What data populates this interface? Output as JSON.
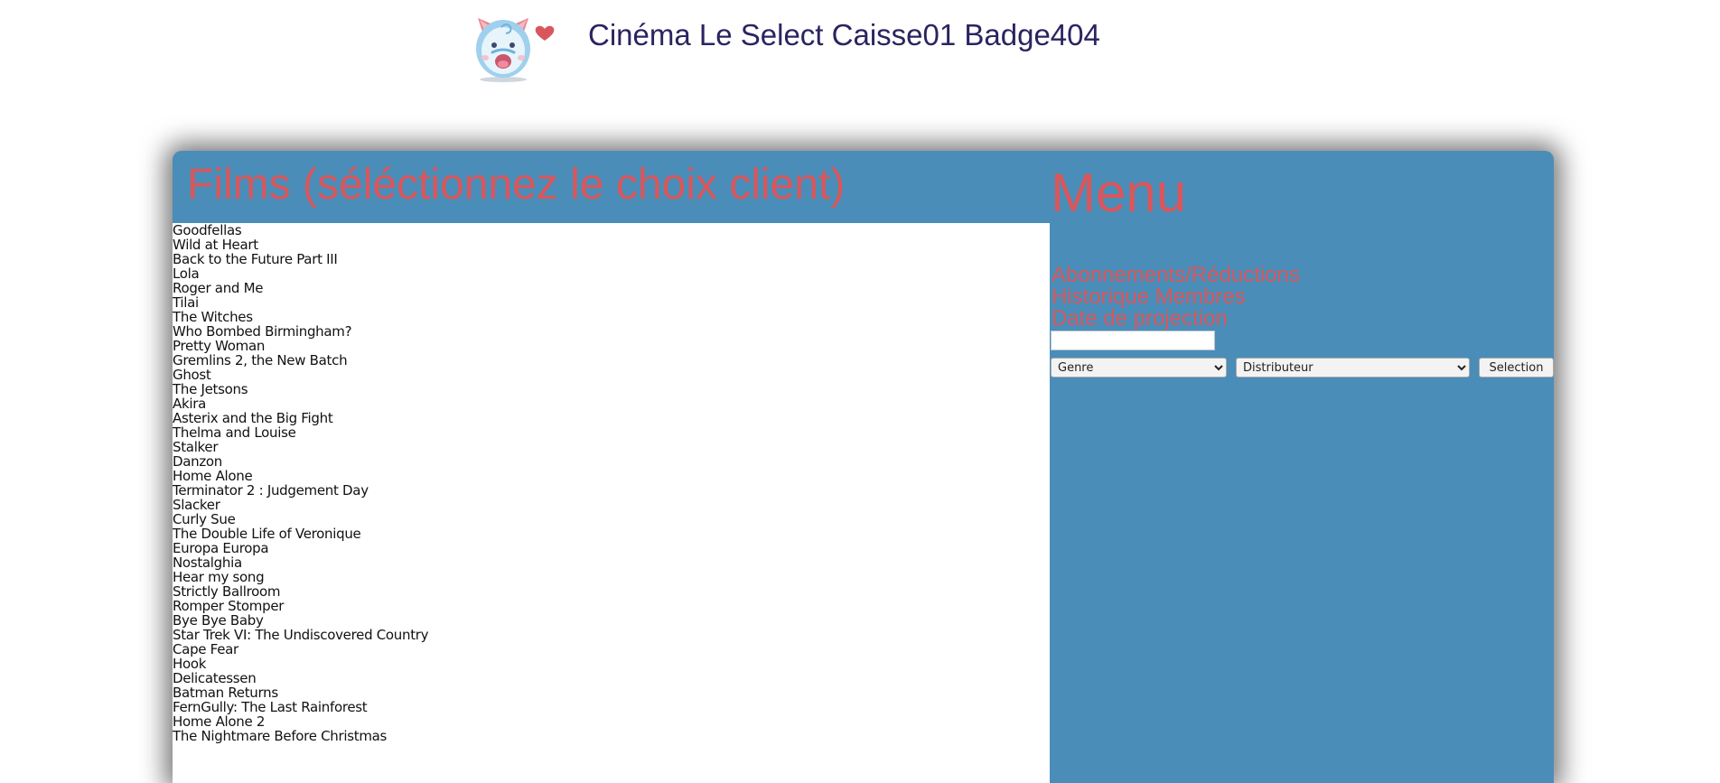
{
  "header": {
    "site_title": "Cinéma Le Select Caisse01 Badge404"
  },
  "films": {
    "title": "Films (séléctionnez le choix client)",
    "items": [
      "Goodfellas",
      "Wild at Heart",
      "Back to the Future Part III",
      "Lola",
      "Roger and Me",
      "Tilai",
      "The Witches",
      "Who Bombed Birmingham?",
      "Pretty Woman",
      "Gremlins 2, the New Batch",
      "Ghost",
      "The Jetsons",
      "Akira",
      "Asterix and the Big Fight",
      "Thelma and Louise",
      "Stalker",
      "Danzon",
      "Home Alone",
      "Terminator 2 : Judgement Day",
      "Slacker",
      "Curly Sue",
      "The Double Life of Veronique",
      "Europa Europa",
      "Nostalghia",
      "Hear my song",
      "Strictly Ballroom",
      "Romper Stomper",
      "Bye Bye Baby",
      "Star Trek VI: The Undiscovered Country",
      "Cape Fear",
      "Hook",
      "Delicatessen",
      "Batman Returns",
      "FernGully: The Last Rainforest",
      "Home Alone 2",
      "The Nightmare Before Christmas"
    ]
  },
  "menu": {
    "title": "Menu",
    "links": [
      "Abonnements/Réductions",
      "Historique Membres",
      "Date de projection"
    ],
    "date_value": "",
    "genre_select": "Genre",
    "distributor_select": "Distributeur",
    "selection_button": "Selection"
  },
  "colors": {
    "panel": "#4a8db8",
    "accent_text": "#d9575c",
    "title_text": "#2a2460"
  }
}
